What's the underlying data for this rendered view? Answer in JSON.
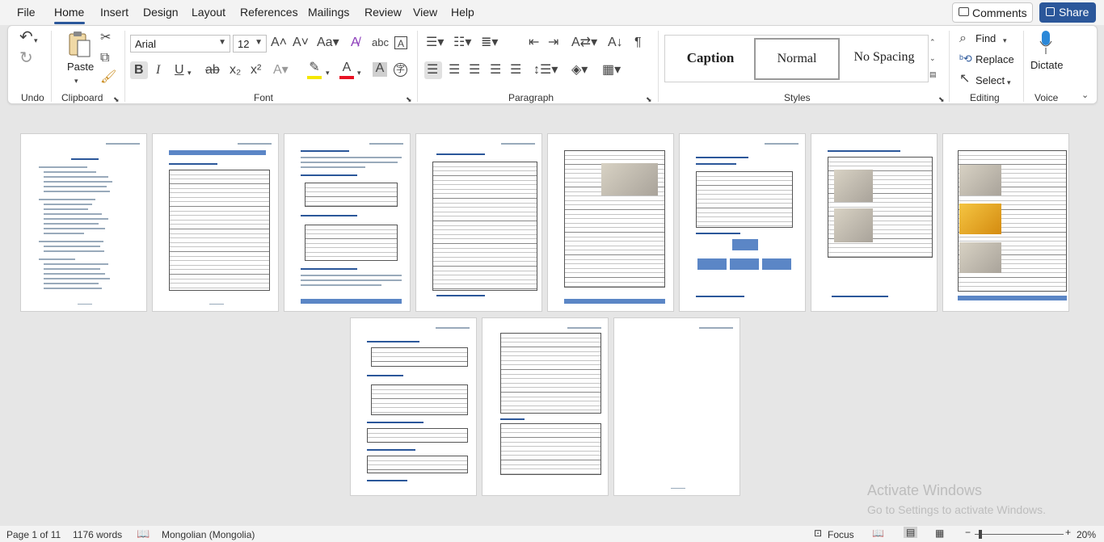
{
  "menu": {
    "tabs": [
      "File",
      "Home",
      "Insert",
      "Design",
      "Layout",
      "References",
      "Mailings",
      "Review",
      "View",
      "Help"
    ],
    "comments": "Comments",
    "share": "Share"
  },
  "ribbon": {
    "groups": {
      "undo": "Undo",
      "clipboard": "Clipboard",
      "font": "Font",
      "paragraph": "Paragraph",
      "styles": "Styles",
      "editing": "Editing",
      "voice": "Voice"
    },
    "paste": "Paste",
    "font_name": "Arial",
    "font_size": "12",
    "styles": [
      "Caption",
      "Normal",
      "No Spacing"
    ],
    "find": "Find",
    "replace": "Replace",
    "select": "Select",
    "dictate": "Dictate",
    "colors": {
      "highlight": "#f5e700",
      "font_color": "#e81123",
      "accent": "#2b579a"
    }
  },
  "watermark": {
    "title": "Activate Windows",
    "subtitle": "Go to Settings to activate Windows."
  },
  "status": {
    "page": "Page 1 of 11",
    "words": "1176 words",
    "language": "Mongolian (Mongolia)",
    "focus": "Focus",
    "zoom": "20%"
  }
}
